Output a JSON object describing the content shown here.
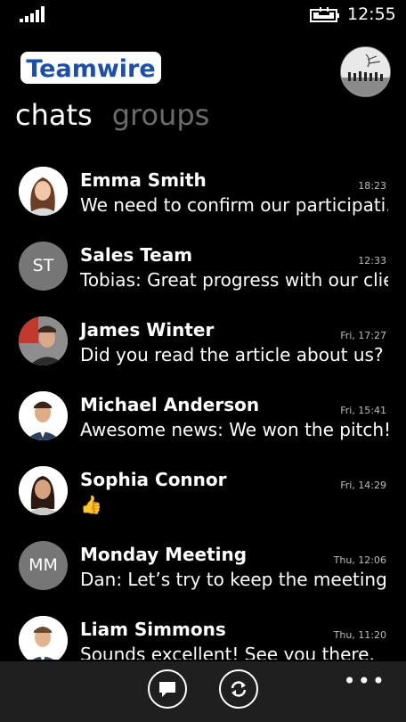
{
  "status_bar": {
    "time": "12:55",
    "icons": [
      "signal-icon",
      "battery-charging-icon"
    ]
  },
  "header": {
    "logo_text": "Teamwire",
    "profile_avatar": "profile-avatar"
  },
  "pivot": {
    "tabs": [
      {
        "label": "chats",
        "active": true
      },
      {
        "label": "groups",
        "active": false
      }
    ]
  },
  "chats": [
    {
      "name": "Emma Smith",
      "time": "18:23",
      "preview": "We need to confirm our participati...",
      "avatar": "photo"
    },
    {
      "name": "Sales Team",
      "time": "12:33",
      "preview": "Tobias: Great progress with our client",
      "avatar": "initials",
      "initials": "ST"
    },
    {
      "name": "James Winter",
      "time": "Fri, 17:27",
      "preview": "Did you read the article about us?",
      "avatar": "photo"
    },
    {
      "name": "Michael Anderson",
      "time": "Fri, 15:41",
      "preview": "Awesome news: We won the pitch!",
      "avatar": "photo"
    },
    {
      "name": "Sophia Connor",
      "time": "Fri, 14:29",
      "preview": "👍",
      "avatar": "photo"
    },
    {
      "name": "Monday Meeting",
      "time": "Thu, 12:06",
      "preview": "Dan: Let’s try to keep the meeting ...",
      "avatar": "initials",
      "initials": "MM"
    },
    {
      "name": "Liam Simmons",
      "time": "Thu, 11:20",
      "preview": "Sounds excellent! See you there.",
      "avatar": "photo"
    }
  ],
  "app_bar": {
    "buttons": [
      "new-message-icon",
      "sync-icon"
    ],
    "more": "•••"
  },
  "colors": {
    "background": "#000000",
    "app_bar": "#1f1f1f",
    "inactive_tab": "#6b6b6b",
    "logo_blue": "#1e4fa8",
    "initials_avatar": "#767676"
  }
}
